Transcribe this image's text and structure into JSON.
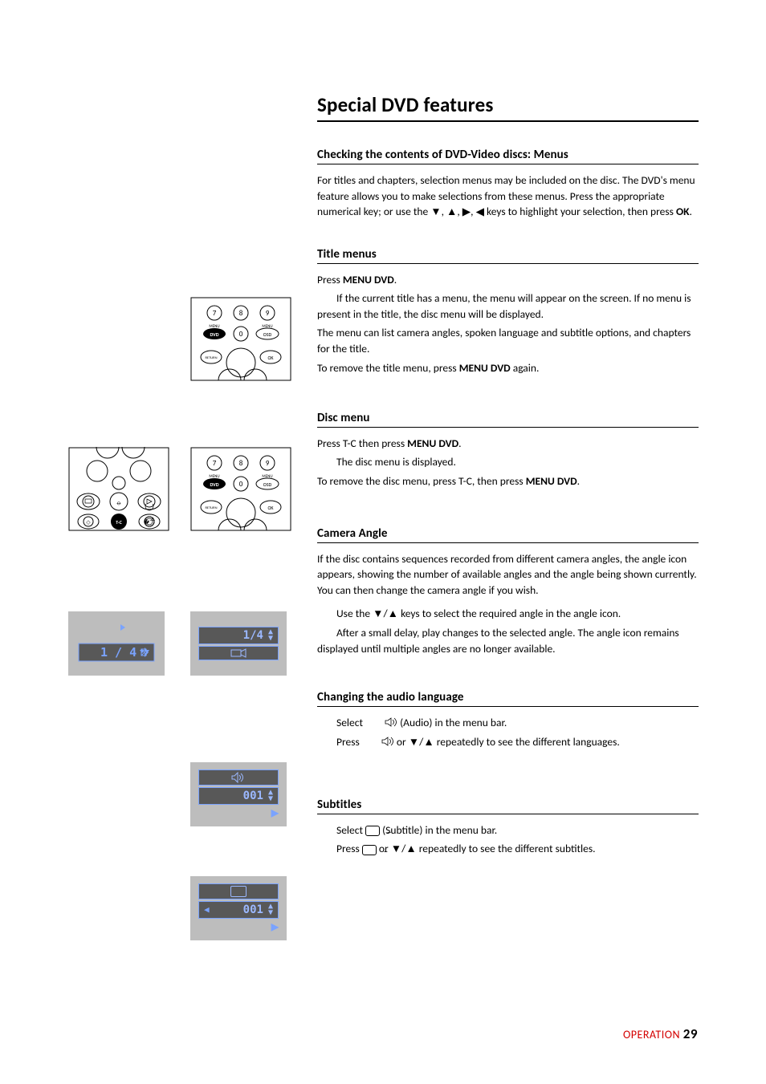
{
  "title": "Special DVD features",
  "sections": {
    "checking": {
      "heading": "Checking the contents of DVD-Video discs: Menus",
      "p1": "For titles and chapters, selection menus may be included on the disc.   The DVD's menu feature allows you to make selections from these menus. Press the appropriate numerical key; or use the ▼, ▲, ▶, ◀ keys to highlight your selection, then press ",
      "p1_bold": "OK",
      "p1_tail": "."
    },
    "title_menus": {
      "heading": "Title menus",
      "l1a": "Press ",
      "l1b": "MENU DVD",
      "l1c": ".",
      "l2": "If the current title has a menu, the menu will appear on the screen. If no menu is present in the title, the disc menu will be displayed.",
      "l3": "The menu can list camera angles, spoken language and subtitle options, and chapters for the title.",
      "l4a": "To remove the title menu, press ",
      "l4b": "MENU DVD",
      "l4c": " again."
    },
    "disc_menu": {
      "heading": "Disc menu",
      "l1a": "Press T-C then press ",
      "l1b": "MENU DVD",
      "l1c": ".",
      "l2": "The disc menu is displayed.",
      "l3a": "To remove the disc menu, press T-C, then press ",
      "l3b": "MENU DVD",
      "l3c": "."
    },
    "camera": {
      "heading": "Camera Angle",
      "p1": "If the disc contains sequences recorded from different camera angles, the angle icon appears, showing the number of available angles and the angle being shown currently. You can then change the camera angle if you wish.",
      "l1": "Use the ▼/▲ keys to select the required angle in the angle icon.",
      "l2": "After a small delay, play changes to the selected angle. The angle icon remains displayed until multiple angles are no longer available."
    },
    "audio": {
      "heading": "Changing the audio language",
      "l1a": "Select ",
      "l1b": " (Audio) in the menu bar.",
      "l2a": "Press ",
      "l2b": " or ▼/▲ repeatedly to see the different languages."
    },
    "subtitles": {
      "heading": "Subtitles",
      "l1a": "Select ",
      "l1b": " (Subtitle) in the menu bar.",
      "l2a": "Press ",
      "l2b": " or ▼/▲ repeatedly to see the different subtitles."
    }
  },
  "figures": {
    "remote1": {
      "btn_menu_dvd": "DVD",
      "btn_menu_osd": "OSD",
      "lbl_menu1": "MENU",
      "lbl_menu2": "MENU",
      "btn_return": "RETURN",
      "btn_ok": "OK",
      "nums": [
        "7",
        "8",
        "9",
        "0"
      ]
    },
    "remote2_tc": "T-C",
    "camera_osd_big": "1 / 4",
    "camera_osd_small": "1/4",
    "audio_osd": "001",
    "subtitle_osd": "001"
  },
  "footer": {
    "label": "OPERATION",
    "page": "29"
  }
}
